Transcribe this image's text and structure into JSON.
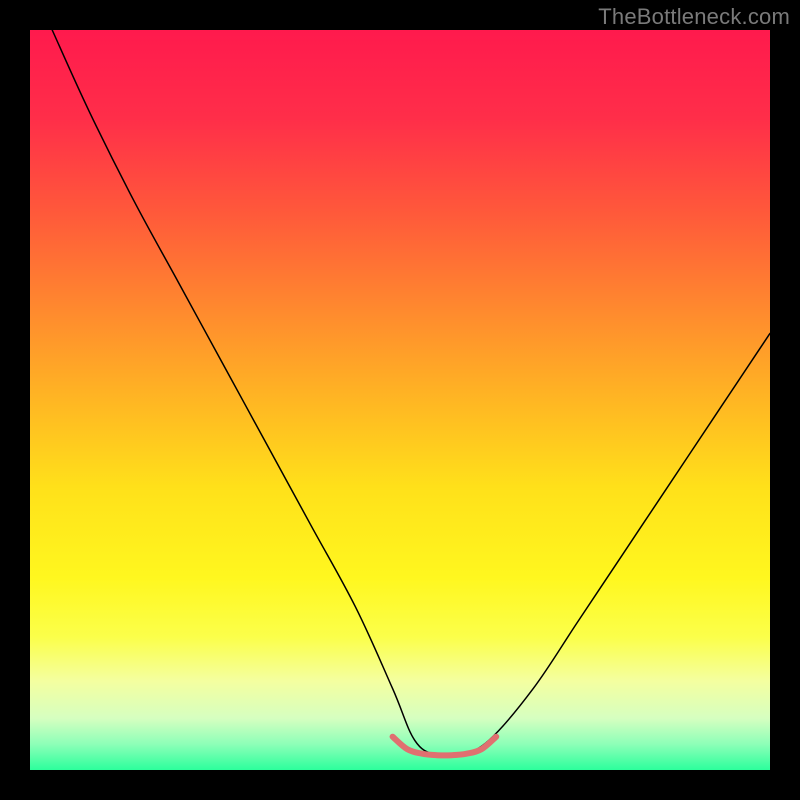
{
  "watermark": "TheBottleneck.com",
  "chart_data": {
    "type": "line",
    "title": "",
    "xlabel": "",
    "ylabel": "",
    "xlim": [
      0,
      100
    ],
    "ylim": [
      0,
      100
    ],
    "background": {
      "type": "vertical-gradient",
      "stops": [
        {
          "pos": 0.0,
          "color": "#ff1a4d"
        },
        {
          "pos": 0.12,
          "color": "#ff2e49"
        },
        {
          "pos": 0.25,
          "color": "#ff5a3a"
        },
        {
          "pos": 0.38,
          "color": "#ff8a2e"
        },
        {
          "pos": 0.5,
          "color": "#ffb623"
        },
        {
          "pos": 0.62,
          "color": "#ffe11a"
        },
        {
          "pos": 0.74,
          "color": "#fff71f"
        },
        {
          "pos": 0.82,
          "color": "#fbff4a"
        },
        {
          "pos": 0.88,
          "color": "#f4ffa0"
        },
        {
          "pos": 0.93,
          "color": "#d6ffc0"
        },
        {
          "pos": 0.965,
          "color": "#8dffb8"
        },
        {
          "pos": 1.0,
          "color": "#2cff9c"
        }
      ]
    },
    "series": [
      {
        "name": "bottleneck-curve",
        "stroke": "#000000",
        "stroke_width": 1.5,
        "x": [
          3,
          8,
          14,
          20,
          26,
          32,
          38,
          44,
          49,
          52,
          55,
          58,
          62,
          68,
          74,
          80,
          86,
          92,
          98,
          100
        ],
        "y": [
          100,
          89,
          77,
          66,
          55,
          44,
          33,
          22,
          11,
          4,
          2,
          2,
          4,
          11,
          20,
          29,
          38,
          47,
          56,
          59
        ]
      },
      {
        "name": "optimal-range-marker",
        "stroke": "#e07070",
        "stroke_width": 6,
        "x": [
          49,
          51,
          53,
          55,
          57,
          59,
          61,
          63
        ],
        "y": [
          4.5,
          2.8,
          2.2,
          2.0,
          2.0,
          2.2,
          2.8,
          4.5
        ]
      }
    ],
    "annotations": []
  }
}
